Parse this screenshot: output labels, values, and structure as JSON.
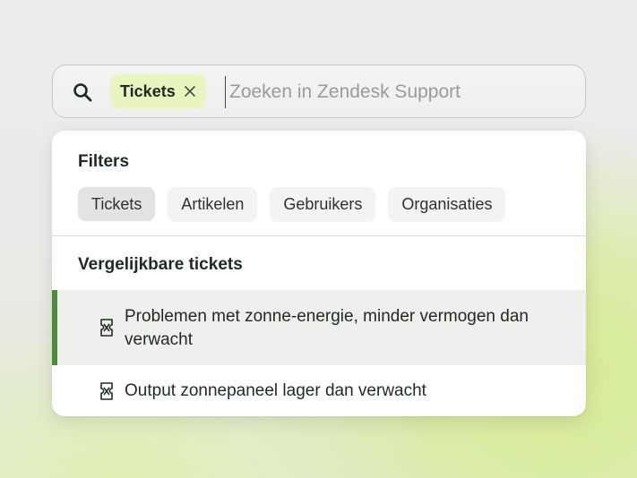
{
  "search": {
    "chip_label": "Tickets",
    "placeholder": "Zoeken in Zendesk Support",
    "value": ""
  },
  "filters": {
    "title": "Filters",
    "items": [
      "Tickets",
      "Artikelen",
      "Gebruikers",
      "Organisaties"
    ],
    "active": "Tickets"
  },
  "similar": {
    "title": "Vergelijkbare tickets",
    "results": [
      {
        "text": "Problemen met zonne-energie, minder vermogen dan verwacht",
        "selected": true
      },
      {
        "text": "Output zonnepaneel lager dan verwacht",
        "selected": false
      }
    ]
  },
  "colors": {
    "chip_bg": "#e9f5be",
    "accent": "#4f8a3f",
    "background_glow": "#d6ec96"
  },
  "icons": {
    "search": "search-icon",
    "chip_close": "close-icon",
    "result": "ticket-icon"
  }
}
